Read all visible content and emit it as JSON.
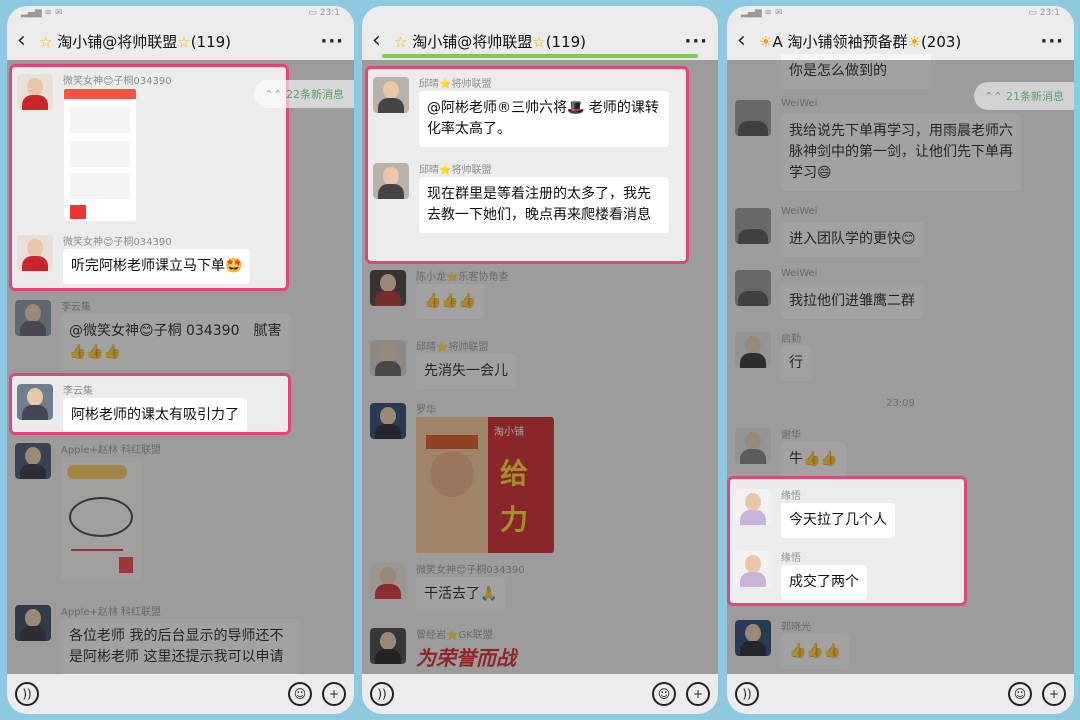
{
  "phone1": {
    "title": "淘小铺@将帅联盟",
    "count": "(119)",
    "new_messages": "22条新消息",
    "messages": [
      {
        "sender": "微笑女神😊子桐034390",
        "image": "order-screenshot"
      },
      {
        "sender": "微笑女神😊子桐034390",
        "text": "听完阿彬老师课立马下单🤩"
      },
      {
        "sender": "李云集",
        "text": "@微笑女神😊子桐 034390　腻害👍👍👍"
      },
      {
        "sender": "李云集",
        "text": "阿彬老师的课太有吸引力了"
      },
      {
        "sender": "Apple+赵林 科红联盟",
        "image": "whiteboard-photo"
      },
      {
        "sender": "Apple+赵林 科红联盟",
        "text": "各位老师 我的后台显示的导师还不是阿彬老师 这里还提示我可以申请"
      }
    ]
  },
  "phone2": {
    "title": "淘小铺@将帅联盟",
    "count": "(119)",
    "messages": [
      {
        "sender": "邱晴⭐将帅联盟",
        "text": "@阿彬老师®三帅六将🎩 老师的课转化率太高了。"
      },
      {
        "sender": "邱晴⭐将帅联盟",
        "text": "现在群里是等着注册的太多了，我先去教一下她们，晚点再来爬楼看消息"
      },
      {
        "sender": "陈小龙⭐乐客协角查",
        "text": "👍👍👍"
      },
      {
        "sender": "邱晴⭐将帅联盟",
        "text": "先消失一会儿"
      },
      {
        "sender": "罗华",
        "image": "sticker",
        "sticker_brand": "淘小铺",
        "sticker_text": "给力"
      },
      {
        "sender": "微笑女神😊子桐034390",
        "text": "干活去了🙏"
      },
      {
        "sender": "曾经岩⭐GK联盟",
        "image": "sticker",
        "sticker_text": "为荣誉而战"
      }
    ]
  },
  "phone3": {
    "title": "A 淘小铺领袖预备群",
    "count": "(203)",
    "new_messages": "21条新消息",
    "first_text": "你是怎么做到的",
    "timestamp": "23:09",
    "messages": [
      {
        "sender": "WeiWei",
        "text": "我给说先下单再学习，用雨晨老师六脉神剑中的第一剑，让他们先下单再学习😄"
      },
      {
        "sender": "WeiWei",
        "text": "进入团队学的更快😊"
      },
      {
        "sender": "WeiWei",
        "text": "我拉他们进雏鹰二群"
      },
      {
        "sender": "启勤",
        "text": "行"
      },
      {
        "sender": "谢华",
        "text": "牛👍👍"
      },
      {
        "sender": "缘悟",
        "text": "今天拉了几个人"
      },
      {
        "sender": "缘悟",
        "text": "成交了两个"
      },
      {
        "sender": "郭晓光",
        "text": "👍👍👍"
      }
    ]
  },
  "colors": {
    "highlight": "#e0457b",
    "background": "#8ec9df",
    "chat_bg": "#ececec"
  }
}
